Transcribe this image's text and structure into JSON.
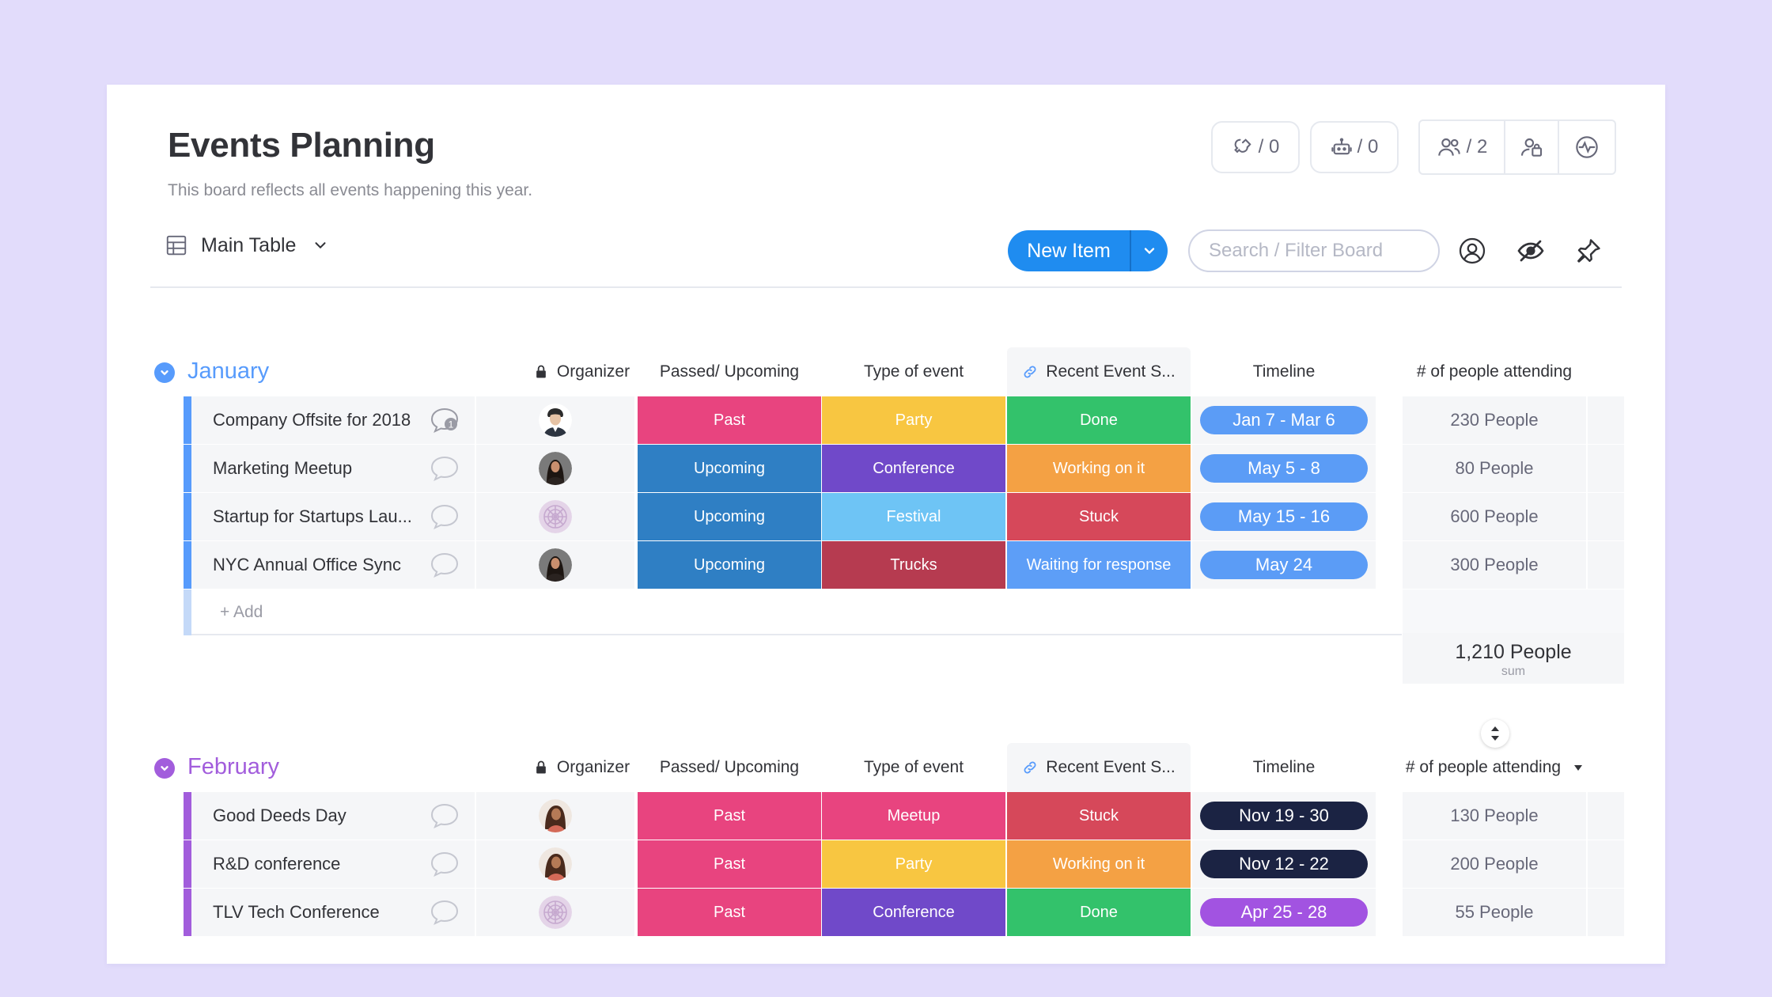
{
  "board": {
    "title": "Events Planning",
    "subtitle": "This board reflects all events happening this year.",
    "integrations_count": "/ 0",
    "automations_count": "/ 0",
    "members_count": "/ 2"
  },
  "toolbar": {
    "view_label": "Main Table",
    "new_item_label": "New Item",
    "search_placeholder": "Search / Filter Board"
  },
  "columns": {
    "organizer": "Organizer",
    "passed_upcoming": "Passed/ Upcoming",
    "type_of_event": "Type of event",
    "recent_event_status": "Recent Event S...",
    "timeline": "Timeline",
    "people_attending": "# of people attending"
  },
  "colors": {
    "past": "#e8447f",
    "upcoming": "#2f7fc4",
    "party": "#f8c641",
    "conference": "#7049c9",
    "festival": "#6ec4f5",
    "trucks": "#b63b50",
    "meetup": "#e8447f",
    "done": "#33c26b",
    "working": "#f4a144",
    "stuck": "#d6485a",
    "waiting": "#5d9ef7",
    "timeline_blue": "#5b9cf6",
    "timeline_dark": "#1b2343",
    "timeline_purple": "#a253e1",
    "group_jan": "#579bfc",
    "group_feb": "#a25ddc"
  },
  "groups": [
    {
      "title": "January",
      "add_label": "+ Add",
      "sum_value": "1,210 People",
      "sum_label": "sum",
      "items": [
        {
          "name": "Company Offsite for 2018",
          "passed": "Past",
          "type": "Party",
          "recent": "Done",
          "timeline": "Jan 7 - Mar 6",
          "people": "230 People"
        },
        {
          "name": "Marketing Meetup",
          "passed": "Upcoming",
          "type": "Conference",
          "recent": "Working on it",
          "timeline": "May 5 - 8",
          "people": "80 People"
        },
        {
          "name": "Startup for Startups Lau...",
          "passed": "Upcoming",
          "type": "Festival",
          "recent": "Stuck",
          "timeline": "May 15 - 16",
          "people": "600 People"
        },
        {
          "name": "NYC Annual Office Sync",
          "passed": "Upcoming",
          "type": "Trucks",
          "recent": "Waiting for response",
          "timeline": "May 24",
          "people": "300 People"
        }
      ]
    },
    {
      "title": "February",
      "items": [
        {
          "name": "Good Deeds Day",
          "passed": "Past",
          "type": "Meetup",
          "recent": "Stuck",
          "timeline": "Nov 19 - 30",
          "people": "130 People"
        },
        {
          "name": "R&D conference",
          "passed": "Past",
          "type": "Party",
          "recent": "Working on it",
          "timeline": "Nov 12 - 22",
          "people": "200 People"
        },
        {
          "name": "TLV Tech Conference",
          "passed": "Past",
          "type": "Conference",
          "recent": "Done",
          "timeline": "Apr 25 - 28",
          "people": "55 People"
        }
      ]
    }
  ]
}
